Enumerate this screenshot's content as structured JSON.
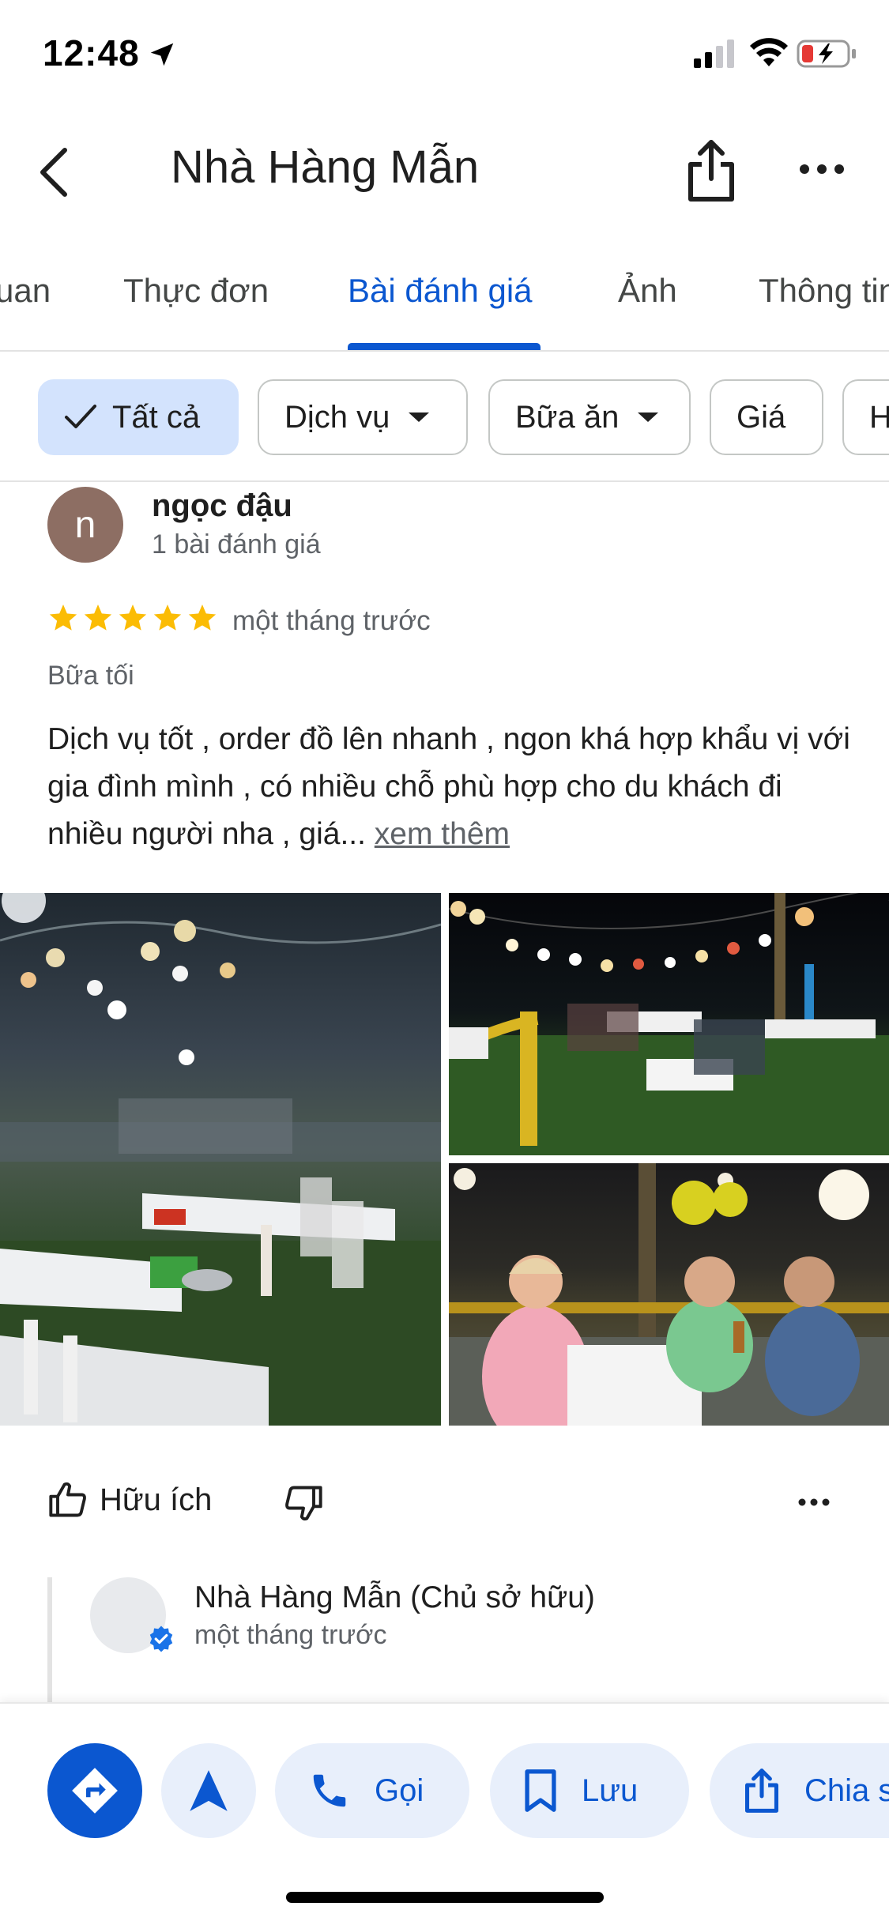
{
  "status_bar": {
    "time": "12:48"
  },
  "header": {
    "title": "Nhà Hàng Mẫn"
  },
  "tabs": [
    {
      "label": "uan"
    },
    {
      "label": "Thực đơn"
    },
    {
      "label": "Bài đánh giá"
    },
    {
      "label": "Ảnh"
    },
    {
      "label": "Thông tin"
    }
  ],
  "filters": [
    {
      "label": "Tất cả"
    },
    {
      "label": "Dịch vụ"
    },
    {
      "label": "Bữa ăn"
    },
    {
      "label": "Giá"
    },
    {
      "label": "H"
    }
  ],
  "review": {
    "avatar_letter": "n",
    "author": "ngọc đậu",
    "author_meta": "1 bài đánh giá",
    "rating": 5,
    "time": "một tháng trước",
    "meal": "Bữa tối",
    "text": "Dịch vụ tốt , order đồ lên nhanh , ngon khá hợp khẩu vị với gia đình mình , có nhiều chỗ phù hợp cho du khách đi nhiều người nha , giá...",
    "more_label": "xem thêm",
    "helpful_label": "Hữu ích"
  },
  "owner_response": {
    "name": "Nhà Hàng Mẫn (Chủ sở hữu)",
    "time": "một tháng trước"
  },
  "bottom_actions": {
    "call_label": "Gọi",
    "save_label": "Lưu",
    "share_label": "Chia sẻ"
  },
  "colors": {
    "accent": "#0b57d0",
    "star": "#fbbc04",
    "chip_selected": "#d3e3fd"
  },
  "icons": [
    "location-arrow-icon",
    "signal-icon",
    "wifi-icon",
    "battery-icon",
    "back-icon",
    "share-icon",
    "more-icon",
    "check-icon",
    "dropdown-icon",
    "star-icon",
    "thumb-up-icon",
    "thumb-down-icon",
    "verified-icon",
    "directions-icon",
    "navigation-icon",
    "phone-icon",
    "bookmark-icon"
  ]
}
